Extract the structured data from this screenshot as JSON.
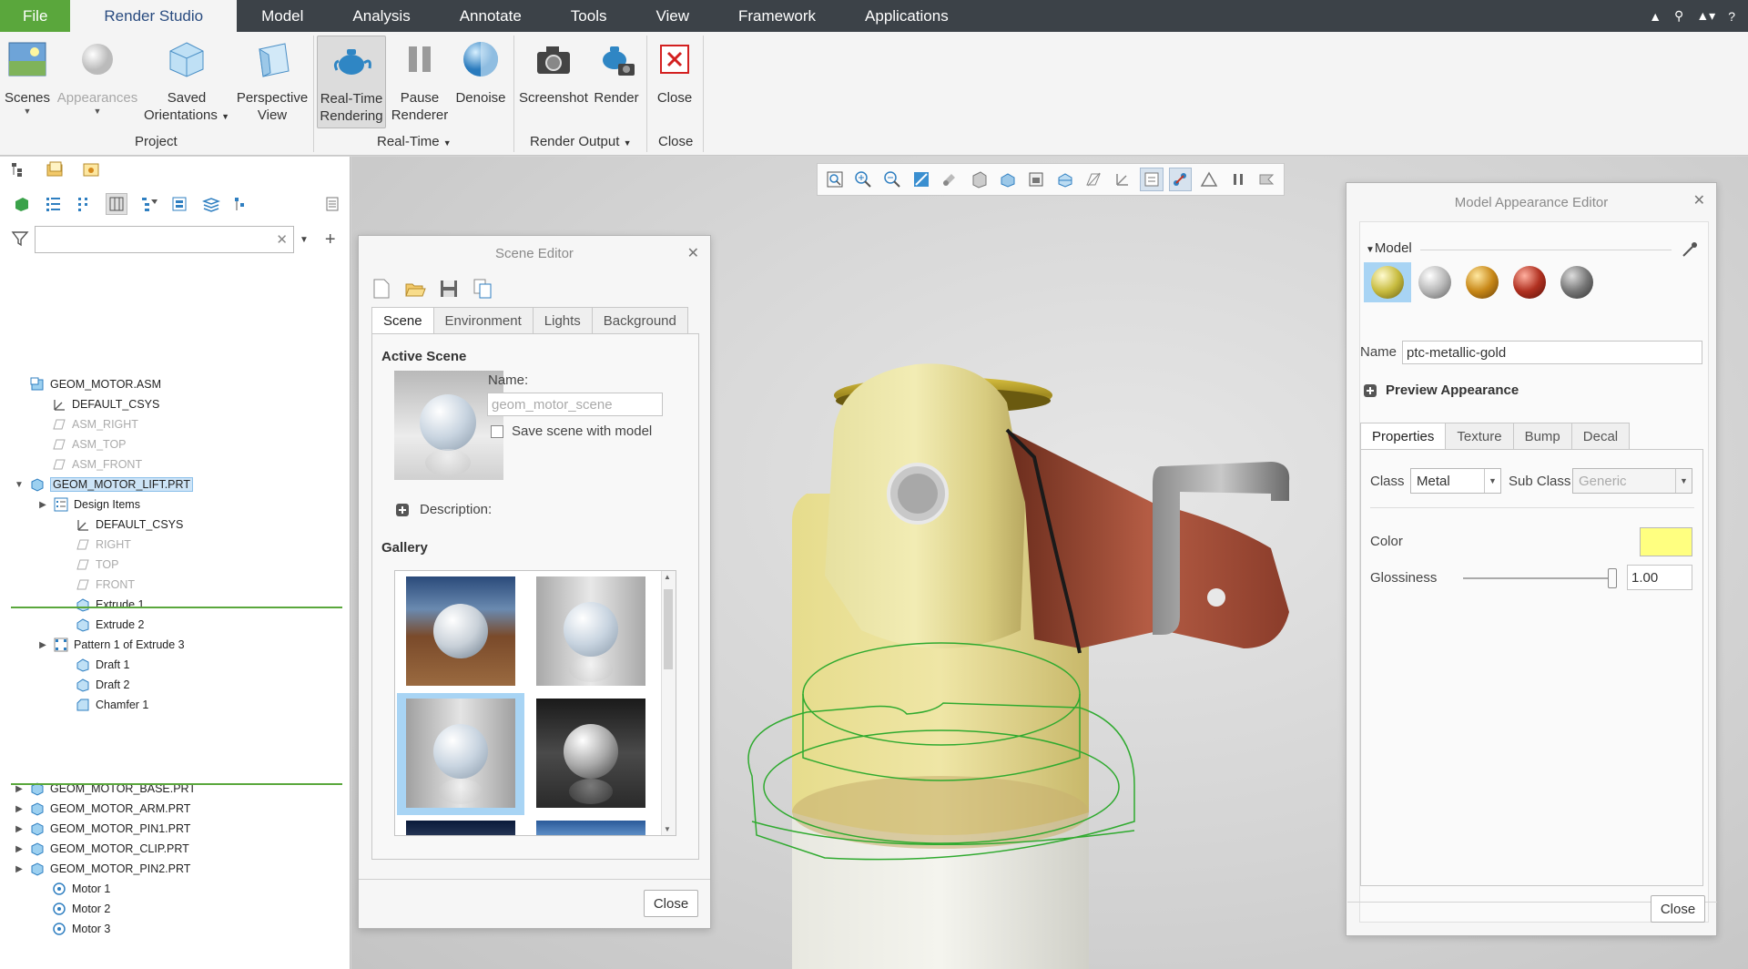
{
  "menubar": {
    "tabs": [
      "File",
      "Render Studio",
      "Model",
      "Analysis",
      "Annotate",
      "Tools",
      "View",
      "Framework",
      "Applications"
    ]
  },
  "ribbon": {
    "buttons": {
      "scenes": "Scenes",
      "appearances": "Appearances",
      "saved_orientations_1": "Saved",
      "saved_orientations_2": "Orientations",
      "perspective_1": "Perspective",
      "perspective_2": "View",
      "realtime_1": "Real-Time",
      "realtime_2": "Rendering",
      "pause_1": "Pause",
      "pause_2": "Renderer",
      "denoise": "Denoise",
      "screenshot": "Screenshot",
      "render": "Render",
      "close": "Close"
    },
    "groups": {
      "project": "Project",
      "realtime": "Real-Time",
      "render_output": "Render Output",
      "close": "Close"
    }
  },
  "tree": {
    "filter_placeholder": "",
    "items": [
      {
        "label": "GEOM_MOTOR.ASM"
      },
      {
        "label": "DEFAULT_CSYS"
      },
      {
        "label": "ASM_RIGHT"
      },
      {
        "label": "ASM_TOP"
      },
      {
        "label": "ASM_FRONT"
      },
      {
        "label": "GEOM_MOTOR_LIFT.PRT"
      },
      {
        "label": "Design Items"
      },
      {
        "label": "DEFAULT_CSYS"
      },
      {
        "label": "RIGHT"
      },
      {
        "label": "TOP"
      },
      {
        "label": "FRONT"
      },
      {
        "label": "Extrude 1"
      },
      {
        "label": "Extrude 2"
      },
      {
        "label": "Pattern 1 of Extrude 3"
      },
      {
        "label": "Draft 1"
      },
      {
        "label": "Draft 2"
      },
      {
        "label": "Chamfer 1"
      },
      {
        "label": "GEOM_MOTOR_BASE.PRT"
      },
      {
        "label": "GEOM_MOTOR_ARM.PRT"
      },
      {
        "label": "GEOM_MOTOR_PIN1.PRT"
      },
      {
        "label": "GEOM_MOTOR_CLIP.PRT"
      },
      {
        "label": "GEOM_MOTOR_PIN2.PRT"
      },
      {
        "label": "Motor 1"
      },
      {
        "label": "Motor 2"
      },
      {
        "label": "Motor 3"
      }
    ]
  },
  "scene_editor": {
    "title": "Scene Editor",
    "tabs": [
      "Scene",
      "Environment",
      "Lights",
      "Background"
    ],
    "active_scene_label": "Active Scene",
    "name_label": "Name:",
    "name_value": "geom_motor_scene",
    "save_with_model": "Save scene with model",
    "description_label": "Description:",
    "gallery_label": "Gallery",
    "close": "Close"
  },
  "appearance_editor": {
    "title": "Model Appearance Editor",
    "model_label": "Model",
    "name_label": "Name",
    "name_value": "ptc-metallic-gold",
    "preview_label": "Preview Appearance",
    "tabs": [
      "Properties",
      "Texture",
      "Bump",
      "Decal"
    ],
    "class_label": "Class",
    "class_value": "Metal",
    "subclass_label": "Sub Class",
    "subclass_value": "Generic",
    "color_label": "Color",
    "color_value": "#ffff80",
    "glossiness_label": "Glossiness",
    "glossiness_value": "1.00",
    "close": "Close"
  }
}
